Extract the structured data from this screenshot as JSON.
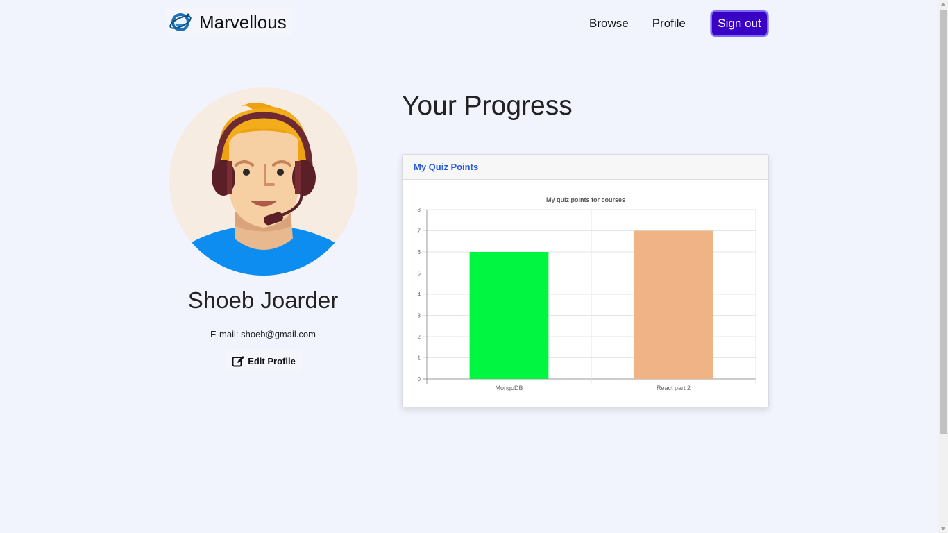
{
  "navbar": {
    "brand": "Marvellous",
    "links": [
      "Browse",
      "Profile"
    ],
    "signout_label": "Sign out"
  },
  "profile": {
    "name": "Shoeb Joarder",
    "email": "E-mail: shoeb@gmail.com",
    "edit_label": "Edit Profile"
  },
  "progress": {
    "title": "Your Progress",
    "card_title": "My Quiz Points"
  },
  "chart_data": {
    "type": "bar",
    "title": "My quiz points for courses",
    "categories": [
      "MongoDB",
      "React part 2"
    ],
    "values": [
      6,
      7
    ],
    "colors": [
      "#00f640",
      "#f0b386"
    ],
    "ylim": [
      0,
      8
    ],
    "yticks": [
      0,
      1,
      2,
      3,
      4,
      5,
      6,
      7,
      8
    ],
    "grid": true,
    "xlabel": "",
    "ylabel": ""
  },
  "colors": {
    "accent": "#3a02c4",
    "card_title": "#2a5bd7",
    "background": "#f1f4fd"
  }
}
